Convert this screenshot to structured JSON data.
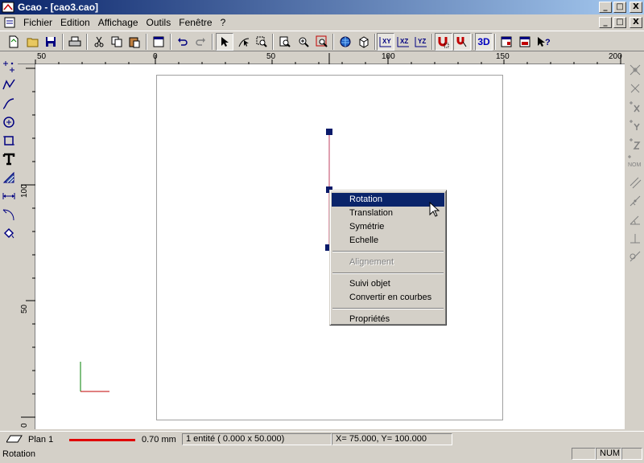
{
  "window": {
    "title": "Gcao - [cao3.cao]",
    "caption_buttons": [
      "_",
      "□",
      "X"
    ]
  },
  "menu": {
    "items": [
      "Fichier",
      "Edition",
      "Affichage",
      "Outils",
      "Fenêtre",
      "?"
    ]
  },
  "toolbar": {
    "view3d_label": "3D",
    "plane_labels": [
      "XY",
      "XZ",
      "YZ"
    ]
  },
  "right_toolbar": {
    "nom_label": "NOM"
  },
  "ruler_h": {
    "labels": [
      "50",
      "0",
      "50",
      "100",
      "150",
      "200"
    ]
  },
  "ruler_v": {
    "labels": [
      "100",
      "50",
      "0"
    ]
  },
  "context_menu": {
    "items": [
      {
        "label": "Rotation",
        "highlighted": true
      },
      {
        "label": "Translation"
      },
      {
        "label": "Symétrie"
      },
      {
        "label": "Echelle"
      },
      {
        "label": "Alignement",
        "disabled": true
      },
      {
        "label": "Suivi objet"
      },
      {
        "label": "Convertir en courbes"
      },
      {
        "label": "Propriétés"
      }
    ]
  },
  "status": {
    "plan": "Plan 1",
    "line_width": "0.70 mm",
    "line_color": "#e00000",
    "entities": "1 entité (   0.000 x   50.000)",
    "coords": "X=   75.000, Y=   100.000",
    "hint": "Rotation",
    "num": "NUM"
  },
  "colors": {
    "title_bar": "#0a246a",
    "selection_handle": "#0a1a6a",
    "selected_line": "#c04060",
    "axis_x": "#c00000",
    "axis_y": "#008000"
  }
}
